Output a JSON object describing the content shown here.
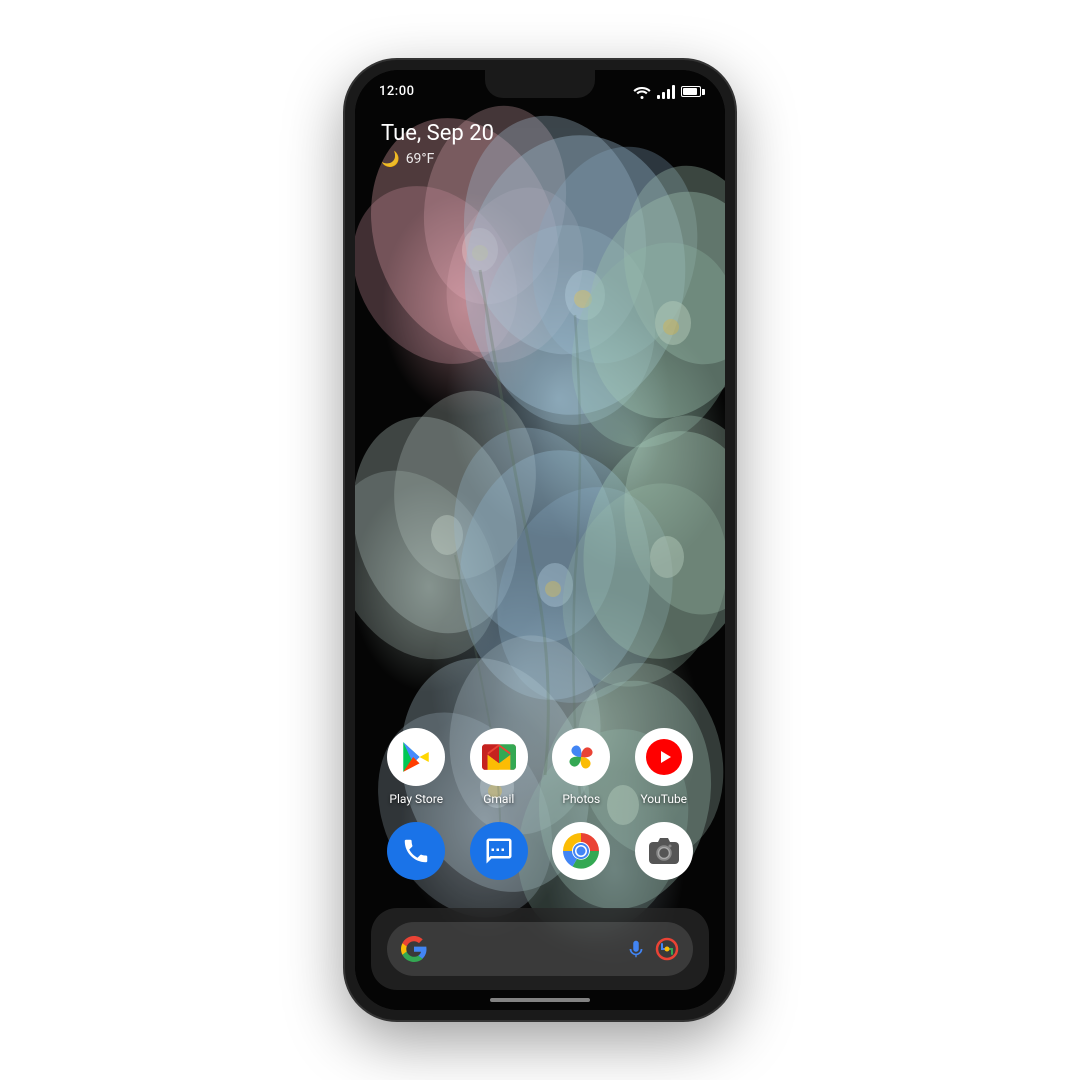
{
  "status_bar": {
    "time": "12:00",
    "wifi": true,
    "signal": true,
    "battery": true
  },
  "date_widget": {
    "date": "Tue, Sep 20",
    "weather_icon": "🌙",
    "temperature": "69°F"
  },
  "app_grid": {
    "row1": [
      {
        "id": "playstore",
        "label": "Play Store"
      },
      {
        "id": "gmail",
        "label": "Gmail"
      },
      {
        "id": "photos",
        "label": "Photos"
      },
      {
        "id": "youtube",
        "label": "YouTube"
      }
    ],
    "row2": [
      {
        "id": "phone",
        "label": ""
      },
      {
        "id": "messages",
        "label": ""
      },
      {
        "id": "chrome",
        "label": ""
      },
      {
        "id": "camera",
        "label": ""
      }
    ]
  },
  "search_bar": {
    "google_label": "G",
    "mic_hint": "microphone",
    "lens_hint": "google lens"
  }
}
